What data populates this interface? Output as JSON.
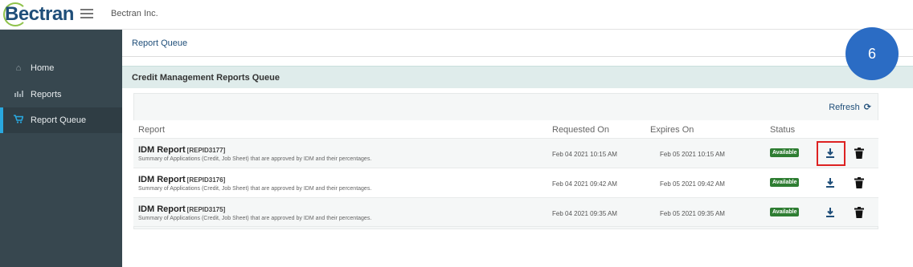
{
  "header": {
    "logo_text": "Bectran",
    "company": "Bectran Inc."
  },
  "sidebar": {
    "items": [
      {
        "label": "Home",
        "icon": "home-icon"
      },
      {
        "label": "Reports",
        "icon": "bar-chart-icon"
      },
      {
        "label": "Report Queue",
        "icon": "cart-icon",
        "active": true
      }
    ]
  },
  "breadcrumb": "Report Queue",
  "panel": {
    "title": "Credit Management Reports Queue",
    "refresh_label": "Refresh"
  },
  "table": {
    "columns": [
      "Report",
      "Requested On",
      "Expires On",
      "Status"
    ],
    "rows": [
      {
        "title": "IDM Report",
        "id": "[REPID3177]",
        "description": "Summary of Applications (Credit, Job Sheet) that are approved by IDM and their percentages.",
        "requested_on": "Feb 04 2021 10:15 AM",
        "expires_on": "Feb 05 2021 10:15 AM",
        "status": "Available"
      },
      {
        "title": "IDM Report",
        "id": "[REPID3176]",
        "description": "Summary of Applications (Credit, Job Sheet) that are approved by IDM and their percentages.",
        "requested_on": "Feb 04 2021 09:42 AM",
        "expires_on": "Feb 05 2021 09:42 AM",
        "status": "Available"
      },
      {
        "title": "IDM Report",
        "id": "[REPID3175]",
        "description": "Summary of Applications (Credit, Job Sheet) that are approved by IDM and their percentages.",
        "requested_on": "Feb 04 2021 09:35 AM",
        "expires_on": "Feb 05 2021 09:35 AM",
        "status": "Available"
      }
    ]
  },
  "step_marker": "6",
  "colors": {
    "sidebar_bg": "#37474f",
    "accent": "#29a8df",
    "status_available": "#2e7d32",
    "highlight": "#dd2222",
    "step_circle": "#2b6cc4"
  }
}
